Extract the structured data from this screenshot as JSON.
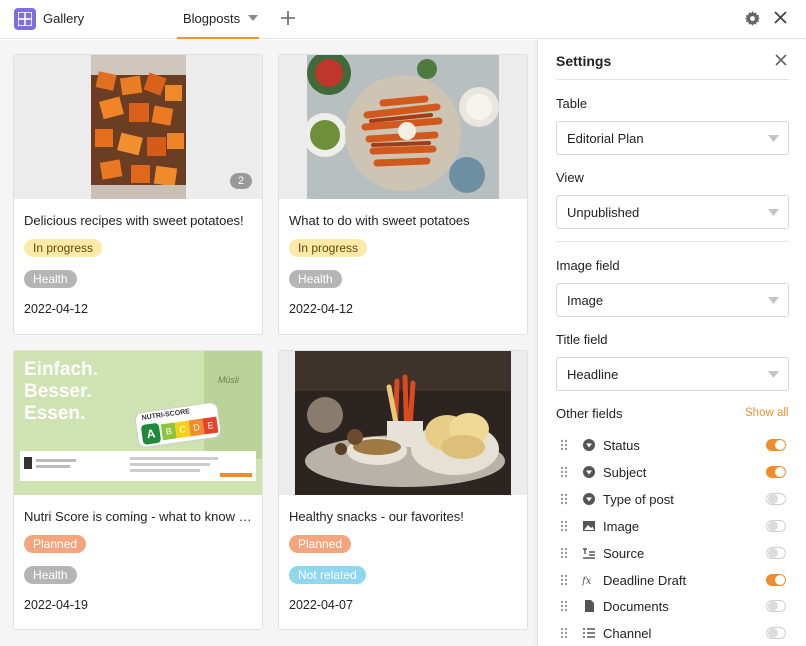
{
  "app": {
    "title": "Gallery"
  },
  "view_tab": {
    "label": "Blogposts"
  },
  "cards": [
    {
      "title": "Delicious recipes with sweet potatoes!",
      "status": "In progress",
      "tag": "Health",
      "date": "2022-04-12",
      "image_count": "2"
    },
    {
      "title": "What to do with sweet potatoes",
      "status": "In progress",
      "tag": "Health",
      "date": "2022-04-12"
    },
    {
      "title": "Nutri Score is coming - what to know about it",
      "status": "Planned",
      "tag": "Health",
      "date": "2022-04-19",
      "image_text": {
        "line1": "Einfach.",
        "line2": "Besser.",
        "line3": "Essen.",
        "nutri": "NUTRI-SCORE",
        "letters": [
          "A",
          "B",
          "C",
          "D",
          "E"
        ],
        "muesli": "Müsli"
      }
    },
    {
      "title": "Healthy snacks - our favorites!",
      "status": "Planned",
      "tag": "Not related",
      "date": "2022-04-07"
    }
  ],
  "settings": {
    "title": "Settings",
    "table_label": "Table",
    "table_value": "Editorial Plan",
    "view_label": "View",
    "view_value": "Unpublished",
    "image_field_label": "Image field",
    "image_field_value": "Image",
    "title_field_label": "Title field",
    "title_field_value": "Headline",
    "other_fields_label": "Other fields",
    "show_all": "Show all",
    "fields": [
      {
        "name": "Status",
        "icon": "single-select-icon",
        "on": true
      },
      {
        "name": "Subject",
        "icon": "single-select-icon",
        "on": true
      },
      {
        "name": "Type of post",
        "icon": "single-select-icon",
        "on": false
      },
      {
        "name": "Image",
        "icon": "image-icon",
        "on": false
      },
      {
        "name": "Source",
        "icon": "long-text-icon",
        "on": false
      },
      {
        "name": "Deadline Draft",
        "icon": "formula-icon",
        "on": true
      },
      {
        "name": "Documents",
        "icon": "file-icon",
        "on": false
      },
      {
        "name": "Channel",
        "icon": "list-icon",
        "on": false
      }
    ]
  },
  "colors": {
    "accent": "#f09232",
    "app_icon": "#7e6fe0",
    "in_progress": "#fde9a8",
    "planned": "#f4a57d",
    "health": "#b5b5b5",
    "not_related": "#8ed7ee"
  }
}
